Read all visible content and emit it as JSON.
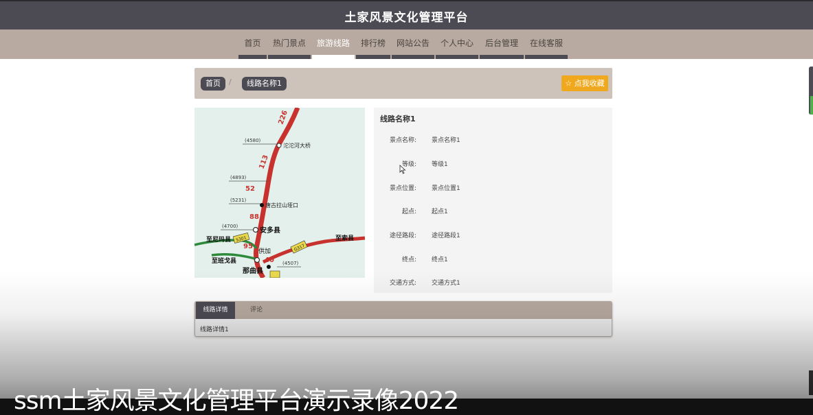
{
  "header": {
    "site_title": "土家风景文化管理平台"
  },
  "nav": {
    "items": [
      {
        "label": "首页",
        "width": 43
      },
      {
        "label": "热门景点",
        "width": 64
      },
      {
        "label": "旅游线路",
        "width": 64,
        "active": true
      },
      {
        "label": "排行榜",
        "width": 52
      },
      {
        "label": "网站公告",
        "width": 64
      },
      {
        "label": "个人中心",
        "width": 64
      },
      {
        "label": "后台管理",
        "width": 66
      },
      {
        "label": "在线客服",
        "width": 64
      }
    ]
  },
  "breadcrumb": {
    "home": "首页",
    "separator": "/",
    "current": "线路名称1"
  },
  "favorite_button": {
    "label": "☆ 点我收藏"
  },
  "map": {
    "labels": {
      "road_226": "226",
      "road_113": "113",
      "dist_52": "52",
      "dist_88": "88",
      "dist_95": "95",
      "dist_40": "40",
      "alt_4580": "(4580)",
      "alt_4893": "(4893)",
      "alt_5231": "(5231)",
      "alt_4700": "(4700)",
      "alt_4507": "(4507)",
      "bridge": "沱沱河大桥",
      "pass": "唐古拉山垭口",
      "anduo": "安多县",
      "to_nima": "至尼玛县",
      "to_suo": "至索县",
      "gongjia": "供加",
      "to_bange": "至班戈县",
      "naqu": "那曲县",
      "s301": "S301",
      "s317": "G317"
    }
  },
  "info": {
    "title": "线路名称1",
    "rows": [
      {
        "key": "景点名称:",
        "value": "景点名称1"
      },
      {
        "key": "等级:",
        "value": "等级1"
      },
      {
        "key": "景点位置:",
        "value": "景点位置1"
      },
      {
        "key": "起点:",
        "value": "起点1"
      },
      {
        "key": "途径路段:",
        "value": "途径路段1"
      },
      {
        "key": "终点:",
        "value": "终点1"
      },
      {
        "key": "交通方式:",
        "value": "交通方式1"
      }
    ]
  },
  "tabs": {
    "items": [
      {
        "label": "线路详情",
        "active": true
      },
      {
        "label": "评论",
        "active": false
      }
    ],
    "content": "线路详情1"
  },
  "video_caption": "ssm土家风景文化管理平台演示录像2022"
}
